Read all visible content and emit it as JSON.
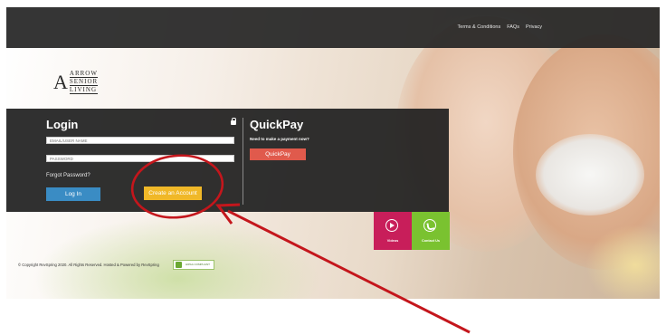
{
  "header": {
    "links": [
      "Terms & Conditions",
      "FAQs",
      "Privacy"
    ]
  },
  "logo": {
    "letter": "A",
    "lines": [
      "ARROW",
      "SENIOR",
      "LIVING"
    ]
  },
  "login": {
    "title": "Login",
    "username_placeholder": "EMAIL/USER NAME",
    "password_placeholder": "PASSWORD",
    "forgot_label": "Forgot Password?",
    "login_button": "Log In",
    "create_button": "Create an Account"
  },
  "quickpay": {
    "title": "QuickPay",
    "prompt": "Need to make a payment now?",
    "button": "QuickPay"
  },
  "tiles": {
    "videos": "Videos",
    "contact": "Contact Us"
  },
  "footer": {
    "copyright": "© Copyright RevSpring 2020. All Rights Reserved. Hosted & Powered by RevSpring",
    "badge_text": "HIPAA COMPLIANT"
  },
  "colors": {
    "header_bg": "#262626",
    "login_button": "#3a8cc4",
    "create_button": "#f0b828",
    "quickpay_button": "#e05a4c",
    "videos_tile": "#c81e5a",
    "contact_tile": "#7ac230",
    "annotation": "#c4161c"
  },
  "icons": [
    "lock-icon",
    "video-icon",
    "phone-icon"
  ]
}
